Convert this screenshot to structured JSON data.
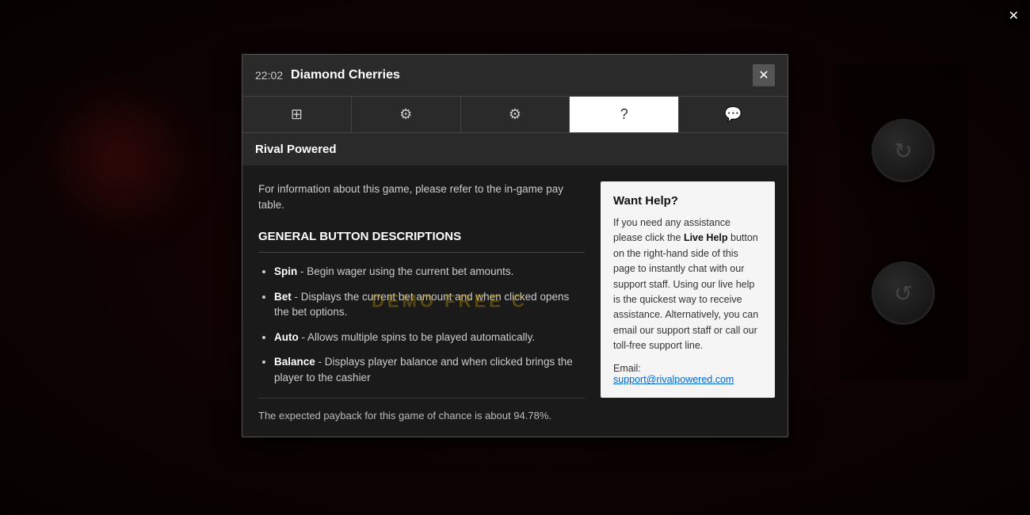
{
  "background": {
    "border_color": "#c8a800"
  },
  "top_close": "✕",
  "modal": {
    "header": {
      "time": "22:02",
      "title": "Diamond Cherries",
      "close_label": "✕"
    },
    "tabs": [
      {
        "id": "paytable",
        "icon": "⊞",
        "label": "Paytable",
        "active": false
      },
      {
        "id": "autoplay",
        "icon": "⚙",
        "label": "Autoplay",
        "active": false
      },
      {
        "id": "settings",
        "icon": "⚙",
        "label": "Settings",
        "active": false
      },
      {
        "id": "help",
        "icon": "?",
        "label": "Help",
        "active": true
      },
      {
        "id": "chat",
        "icon": "💬",
        "label": "Chat",
        "active": false
      }
    ],
    "section_header": "Rival Powered",
    "demo_watermark": "DEMO   FREE C",
    "intro_text": "For information about this game, please refer to the in-game pay table.",
    "general_title": "GENERAL BUTTON DESCRIPTIONS",
    "buttons": [
      {
        "name": "Spin",
        "description": "Begin wager using the current bet amounts."
      },
      {
        "name": "Bet",
        "description": "Displays the current bet amount and when clicked opens the bet options."
      },
      {
        "name": "Auto",
        "description": "Allows multiple spins to be played automatically."
      },
      {
        "name": "Balance",
        "description": "Displays player balance and when clicked brings the player to the cashier"
      }
    ],
    "payback_text": "The expected payback for this game of chance is about 94.78%.",
    "help_box": {
      "title": "Want Help?",
      "body": "If you need any assistance please click the ",
      "live_help": "Live Help",
      "body2": " button on the right-hand side of this page to instantly chat with our support staff. Using our live help is the quickest way to receive assistance. Alternatively, you can email our support staff or call our toll-free support line.",
      "email_label": "Email:",
      "email": "support@rivalpowered.com"
    }
  }
}
